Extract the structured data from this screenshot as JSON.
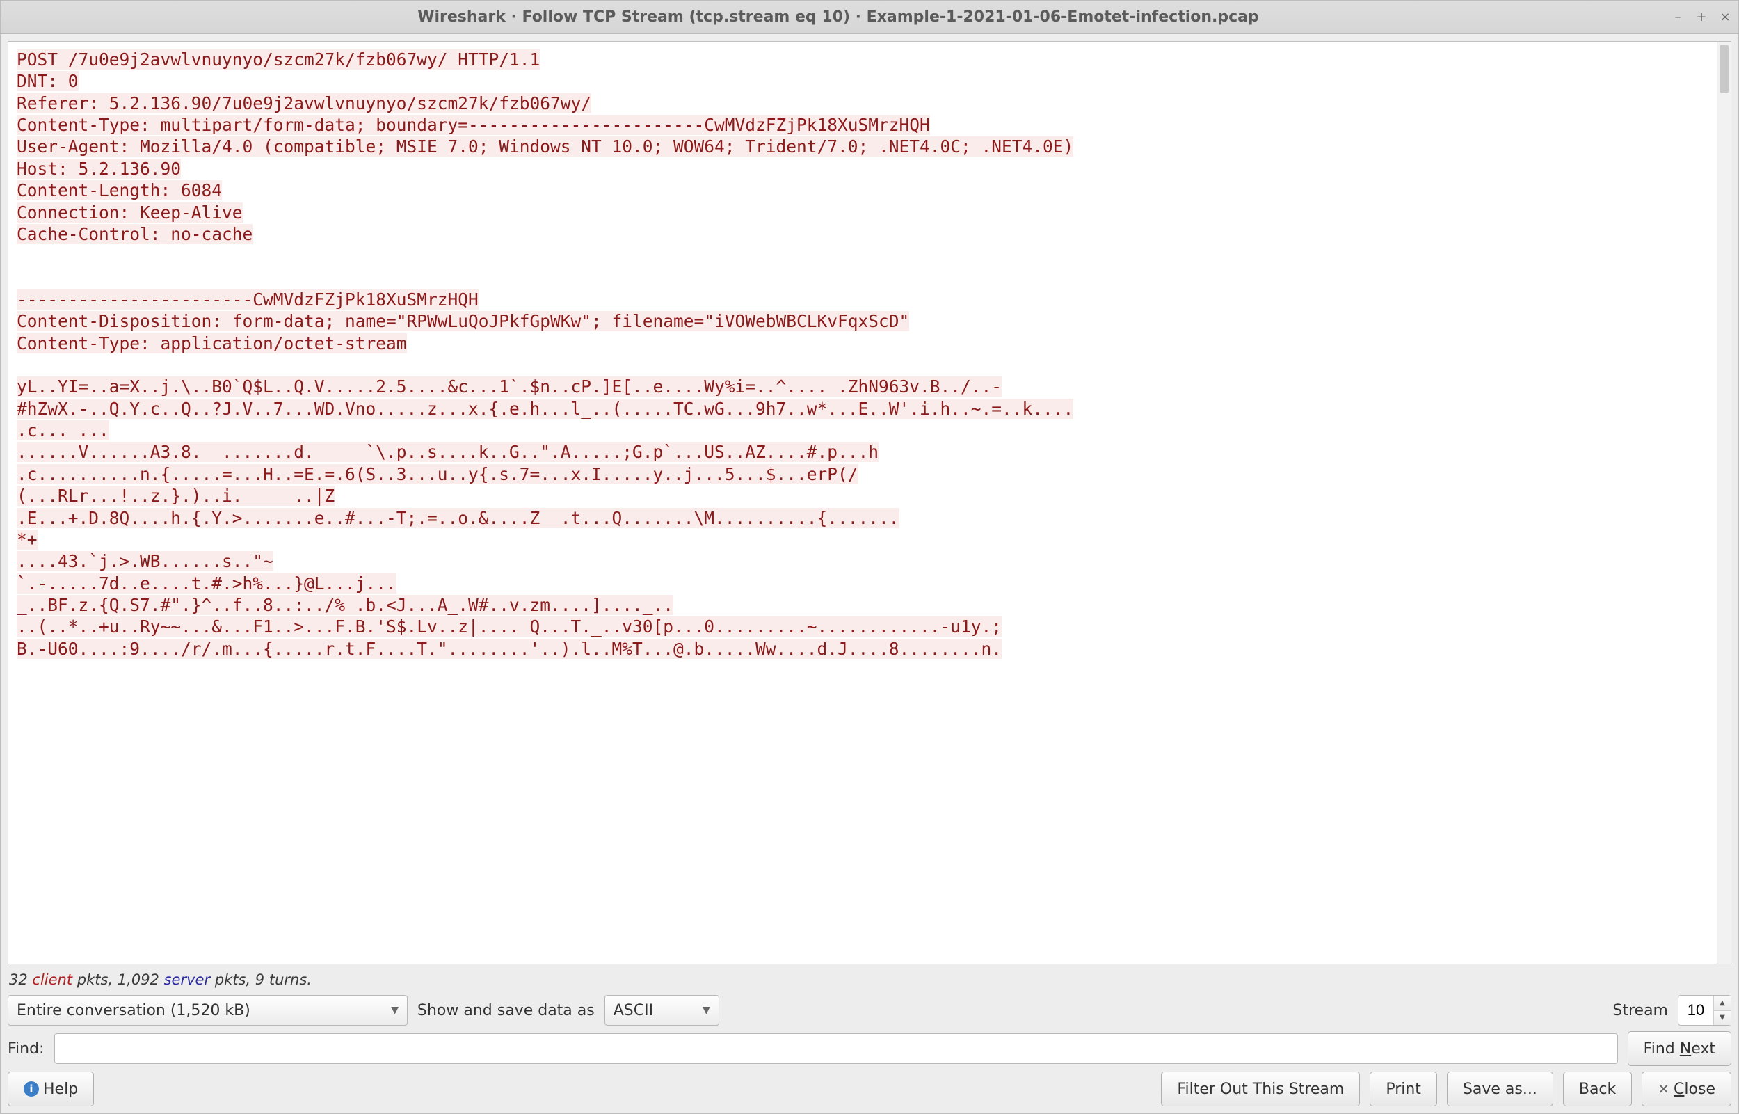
{
  "window": {
    "title": "Wireshark · Follow TCP Stream (tcp.stream eq 10) · Example-1-2021-01-06-Emotet-infection.pcap"
  },
  "stream": {
    "lines": [
      "POST /7u0e9j2avwlvnuynyo/szcm27k/fzb067wy/ HTTP/1.1",
      "DNT: 0",
      "Referer: 5.2.136.90/7u0e9j2avwlvnuynyo/szcm27k/fzb067wy/",
      "Content-Type: multipart/form-data; boundary=-----------------------CwMVdzFZjPk18XuSMrzHQH",
      "User-Agent: Mozilla/4.0 (compatible; MSIE 7.0; Windows NT 10.0; WOW64; Trident/7.0; .NET4.0C; .NET4.0E)",
      "Host: 5.2.136.90",
      "Content-Length: 6084",
      "Connection: Keep-Alive",
      "Cache-Control: no-cache",
      "",
      "",
      "-----------------------CwMVdzFZjPk18XuSMrzHQH",
      "Content-Disposition: form-data; name=\"RPWwLuQoJPkfGpWKw\"; filename=\"iVOWebWBCLKvFqxScD\"",
      "Content-Type: application/octet-stream",
      "",
      "yL..YI=..a=X..j.\\..B0`Q$L..Q.V.....2.5....&c...1`.$n..cP.]E[..e....Wy%i=..^.... .ZhN963v.B../..-",
      "#hZwX.-..Q.Y.c..Q..?J.V..7...WD.Vno.....z...x.{.e.h...l_..(.....TC.wG...9h7..w*...E..W'.i.h..~.=..k....",
      ".c... ...",
      "......V......A3.8.  .......d.     `\\.p..s....k..G..\".A.....;G.p`...US..AZ....#.p...h",
      ".c..........n.{.....=...H..=E.=.6(S..3...u..y{.s.7=...x.I.....y..j...5...$...erP(/",
      "(...RLr...!..z.}.)..i.     ..|Z",
      ".E...+.D.8Q....h.{.Y.>.......e..#...-T;.=..o.&....Z  .t...Q.......\\M..........{.......",
      "*+",
      "....43.`j.>.WB......s..\"~",
      "`.-.....7d..e....t.#.>h%...}@L...j...",
      "_..BF.z.{Q.S7.#\".}^..f..8..:../% .b.<J...A_.W#..v.zm....]...._..",
      "..(..*..+u..Ry~~...&...F1..>...F.B.'S$.Lv..z|.... Q...T._..v30[p...0.........~............-u1y.;",
      "B.-U60....:9..../r/.m...{.....r.t.F....T.\"........'..).l..M%T...@.b.....Ww....d.J....8........n."
    ]
  },
  "stats": {
    "client_pkts": "32",
    "server_pkts": "1,092",
    "turns": "9",
    "prefix_client": " client",
    "prefix_server": " server",
    "label_pkts": " pkts, ",
    "label_turns": " turns."
  },
  "controls": {
    "conversation": "Entire conversation (1,520 kB)",
    "show_label": "Show and save data as",
    "data_as": "ASCII",
    "stream_label": "Stream",
    "stream_value": "10",
    "find_label": "Find:",
    "find_value": "",
    "find_next": "Find Next"
  },
  "buttons": {
    "help": "Help",
    "filter_out": "Filter Out This Stream",
    "print": "Print",
    "save_as": "Save as...",
    "back": "Back",
    "close": "Close"
  }
}
